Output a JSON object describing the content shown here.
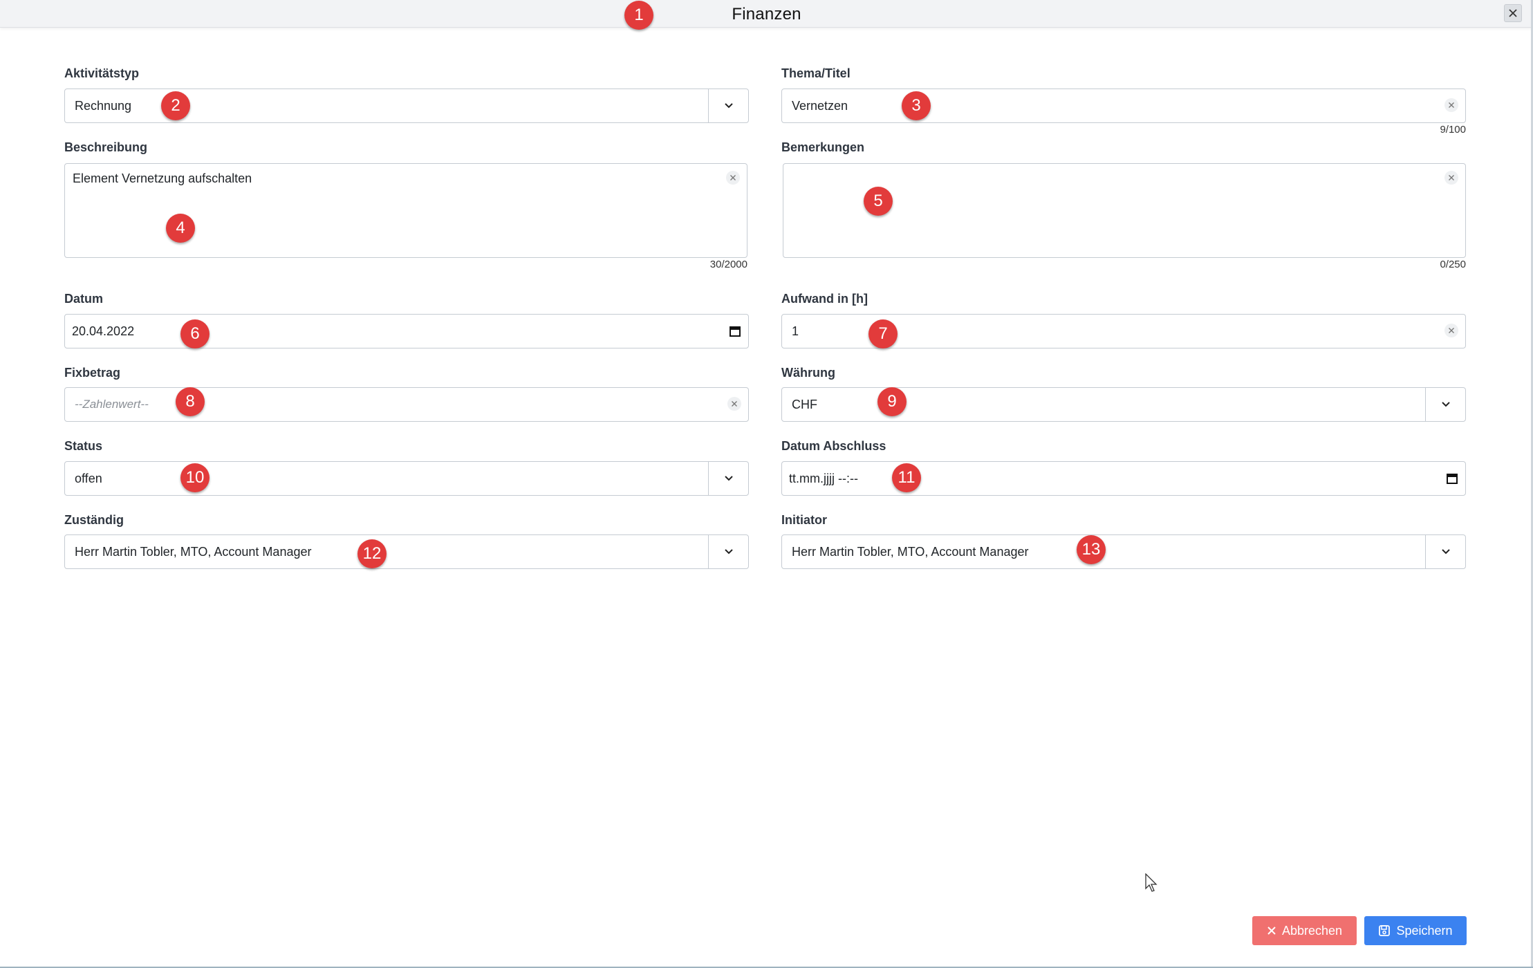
{
  "window": {
    "title": "Finanzen"
  },
  "form": {
    "aktivitaetstyp": {
      "label": "Aktivitätstyp",
      "value": "Rechnung"
    },
    "thema": {
      "label": "Thema/Titel",
      "value": "Vernetzen",
      "counter": "9/100"
    },
    "beschreibung": {
      "label": "Beschreibung",
      "value": "Element Vernetzung aufschalten",
      "counter": "30/2000"
    },
    "bemerkungen": {
      "label": "Bemerkungen",
      "value": "",
      "counter": "0/250"
    },
    "datum": {
      "label": "Datum",
      "value": "20.04.2022"
    },
    "aufwand": {
      "label": "Aufwand in [h]",
      "value": "1"
    },
    "fixbetrag": {
      "label": "Fixbetrag",
      "placeholder": "--Zahlenwert--"
    },
    "waehrung": {
      "label": "Währung",
      "value": "CHF"
    },
    "status": {
      "label": "Status",
      "value": "offen"
    },
    "datum_abschluss": {
      "label": "Datum Abschluss",
      "value": "tt.mm.jjjj --:--"
    },
    "zustaendig": {
      "label": "Zuständig",
      "value": "Herr Martin Tobler, MTO, Account Manager"
    },
    "initiator": {
      "label": "Initiator",
      "value": "Herr Martin Tobler, MTO, Account Manager"
    }
  },
  "buttons": {
    "cancel": "Abbrechen",
    "save": "Speichern"
  },
  "markers": [
    "1",
    "2",
    "3",
    "4",
    "5",
    "6",
    "7",
    "8",
    "9",
    "10",
    "11",
    "12",
    "13"
  ],
  "colors": {
    "marker": "#e23b3b",
    "cancel": "#f0706f",
    "save": "#3b82f0"
  }
}
